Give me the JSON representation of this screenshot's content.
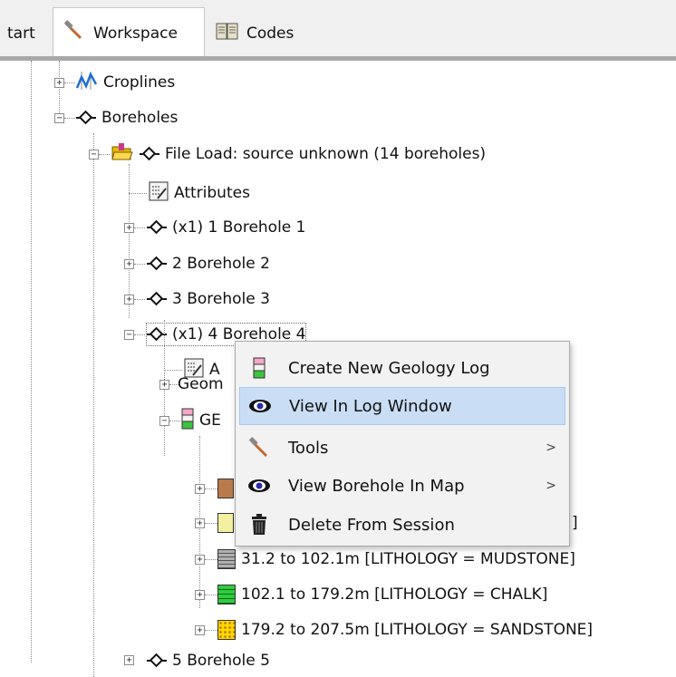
{
  "tabs": [
    {
      "label": "tart",
      "icon": null
    },
    {
      "label": "Workspace",
      "icon": "hammer-icon"
    },
    {
      "label": "Codes",
      "icon": "book-icon"
    }
  ],
  "tree": {
    "croplines": "Croplines",
    "boreholes": "Boreholes",
    "file_load": "File Load: source unknown (14 boreholes)",
    "attributes": "Attributes",
    "bh1": "(x1) 1 Borehole 1",
    "bh2": "2 Borehole 2",
    "bh3": "3 Borehole 3",
    "bh4": "(x1) 4 Borehole 4",
    "bh4_attr": "A",
    "geom": "Geom",
    "geo": "GE",
    "layer3": "31.2 to 102.1m   [LITHOLOGY = MUDSTONE]",
    "layer4": "102.1 to 179.2m   [LITHOLOGY = CHALK]",
    "layer5": "179.2 to 207.5m   [LITHOLOGY = SANDSTONE]",
    "bh5": "5 Borehole 5",
    "layer2_tail": "]"
  },
  "context_menu": {
    "items": [
      {
        "label": "Create New Geology Log",
        "icon": "geology-log-icon",
        "submenu": false
      },
      {
        "label": "View In Log Window",
        "icon": "eye-icon",
        "submenu": false,
        "highlighted": true
      },
      {
        "label": "Tools",
        "icon": "hammer-icon",
        "submenu": true
      },
      {
        "label": "View Borehole In Map",
        "icon": "eye-icon",
        "submenu": true
      },
      {
        "label": "Delete From Session",
        "icon": "trash-icon",
        "submenu": false
      }
    ],
    "arrow": ">"
  },
  "colors": {
    "highlight": "#c9def5",
    "mudstone": "#b0b0b0",
    "chalk": "#2ecc40",
    "sandstone": "#ffd700",
    "brown_layer": "#b87a4b"
  }
}
